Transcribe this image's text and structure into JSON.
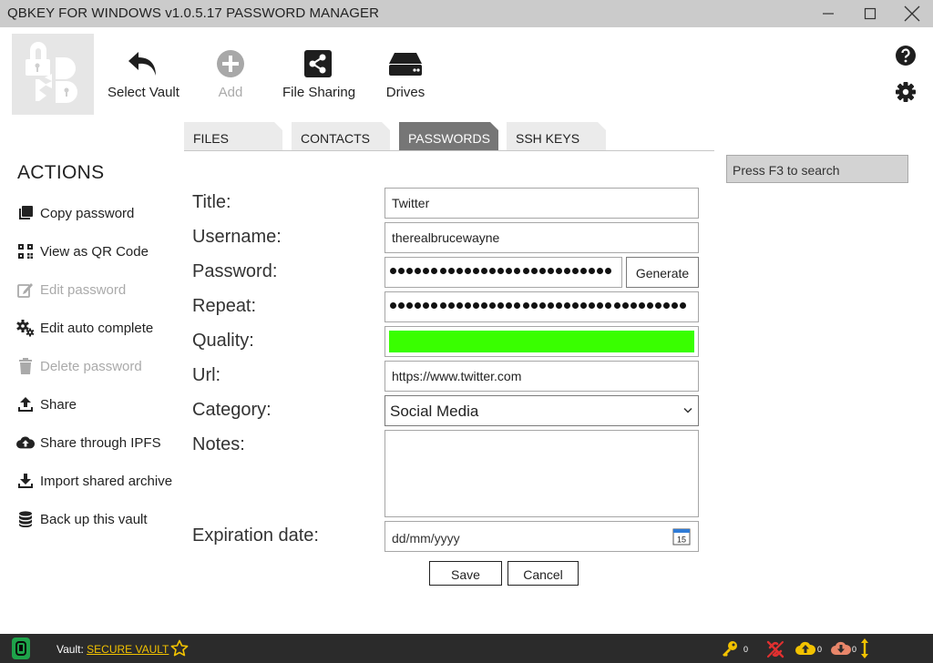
{
  "window": {
    "title": "QBKEY FOR WINDOWS v1.0.5.17  PASSWORD MANAGER"
  },
  "toolbar": {
    "select_vault": "Select Vault",
    "add": "Add",
    "file_sharing": "File Sharing",
    "drives": "Drives"
  },
  "tabs": [
    {
      "label": "FILES",
      "active": false
    },
    {
      "label": "CONTACTS",
      "active": false
    },
    {
      "label": "PASSWORDS",
      "active": true
    },
    {
      "label": "SSH KEYS",
      "active": false
    }
  ],
  "search": {
    "placeholder": "Press F3 to search"
  },
  "actions": {
    "title": "ACTIONS",
    "items": [
      {
        "label": "Copy password",
        "icon": "copy-icon",
        "enabled": true
      },
      {
        "label": "View as QR Code",
        "icon": "qr-code-icon",
        "enabled": true
      },
      {
        "label": "Edit password",
        "icon": "edit-icon",
        "enabled": false
      },
      {
        "label": "Edit auto complete",
        "icon": "gears-icon",
        "enabled": true
      },
      {
        "label": "Delete password",
        "icon": "trash-icon",
        "enabled": false
      },
      {
        "label": "Share",
        "icon": "share-upload-icon",
        "enabled": true
      },
      {
        "label": "Share through IPFS",
        "icon": "cloud-upload-icon",
        "enabled": true
      },
      {
        "label": "Import shared archive",
        "icon": "download-icon",
        "enabled": true
      },
      {
        "label": "Back up this vault",
        "icon": "database-icon",
        "enabled": true
      }
    ]
  },
  "form": {
    "title_label": "Title:",
    "title_value": "Twitter",
    "username_label": "Username:",
    "username_value": "therealbrucewayne",
    "password_label": "Password:",
    "generate_label": "Generate",
    "repeat_label": "Repeat:",
    "quality_label": "Quality:",
    "quality_level": 1.0,
    "quality_color": "#39ff00",
    "url_label": "Url:",
    "url_value": "https://www.twitter.com",
    "category_label": "Category:",
    "category_value": "Social Media",
    "notes_label": "Notes:",
    "notes_value": "",
    "expiration_label": "Expiration date:",
    "expiration_placeholder": "dd/mm/yyyy",
    "calendar_day": "15",
    "save_label": "Save",
    "cancel_label": "Cancel"
  },
  "statusbar": {
    "vault_prefix": "Vault:",
    "vault_name": "SECURE VAULT",
    "keys_count": "0",
    "upload_count": "0",
    "download_count": "0"
  },
  "colors": {
    "titlebar": "#cbcbcb",
    "active_tab": "#767676",
    "statusbar": "#2b2b2b",
    "vault_link": "#f2c200",
    "accent_green": "#39ff00"
  }
}
